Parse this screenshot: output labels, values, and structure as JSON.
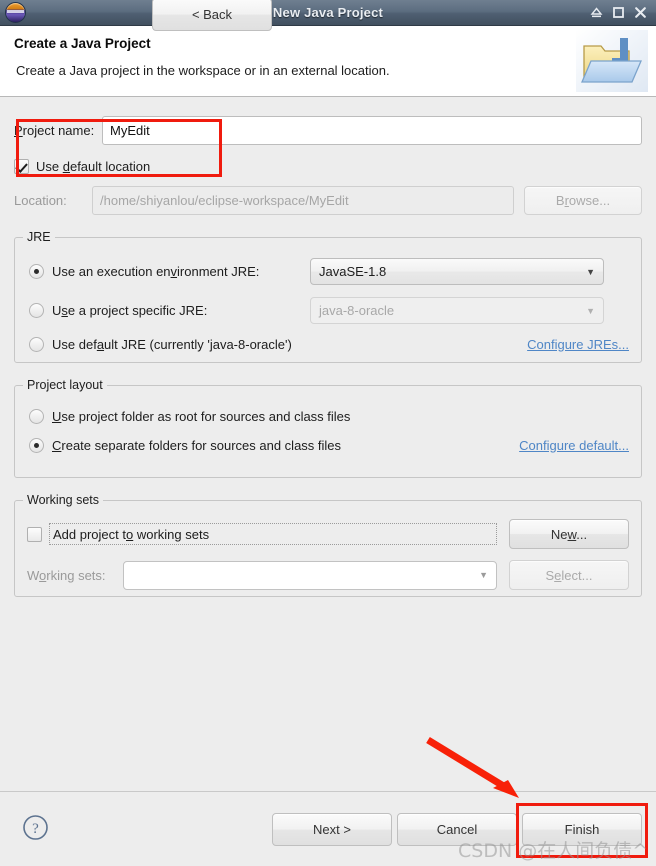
{
  "window": {
    "title": "New Java Project",
    "app_icon": "eclipse-icon",
    "controls": [
      {
        "name": "minimize-button",
        "icon": "minimize-icon"
      },
      {
        "name": "maximize-button",
        "icon": "maximize-icon"
      },
      {
        "name": "close-button",
        "icon": "close-icon"
      }
    ]
  },
  "header": {
    "title": "Create a Java Project",
    "subtitle": "Create a Java project in the workspace or in an external location.",
    "icon": "java-project-folder-icon"
  },
  "project": {
    "name_label": "Project name:",
    "name_label_accel": "P",
    "name_value": "MyEdit",
    "use_default_location_label": "Use default location",
    "use_default_location_accel": "d",
    "use_default_location_checked": true,
    "location_label": "Location:",
    "location_value": "/home/shiyanlou/eclipse-workspace/MyEdit",
    "browse_label": "Browse...",
    "browse_accel": "r",
    "browse_enabled": false
  },
  "jre": {
    "group_title": "JRE",
    "options": [
      {
        "label": "Use an execution environment JRE:",
        "accel": "v",
        "selected": true
      },
      {
        "label": "Use a project specific JRE:",
        "accel": "s",
        "selected": false
      },
      {
        "label": "Use default JRE (currently 'java-8-oracle')",
        "accel": "a",
        "selected": false
      }
    ],
    "execution_env_value": "JavaSE-1.8",
    "specific_jre_value": "java-8-oracle",
    "specific_jre_enabled": false,
    "configure_link": "Configure JREs..."
  },
  "layout": {
    "group_title": "Project layout",
    "options": [
      {
        "label": "Use project folder as root for sources and class files",
        "accel": "U",
        "selected": false
      },
      {
        "label": "Create separate folders for sources and class files",
        "accel": "C",
        "selected": true
      }
    ],
    "configure_link": "Configure default..."
  },
  "working_sets": {
    "group_title": "Working sets",
    "add_label": "Add project to working sets",
    "add_accel": "o",
    "add_checked": false,
    "new_label": "New...",
    "new_accel": "w",
    "sets_label": "Working sets:",
    "sets_label_accel": "o",
    "sets_value": "",
    "select_label": "Select...",
    "select_accel": "e",
    "select_enabled": false
  },
  "footer": {
    "help_icon": "help-question-icon",
    "buttons": [
      {
        "name": "back-button",
        "label": "< Back",
        "enabled": true
      },
      {
        "name": "next-button",
        "label": "Next >",
        "enabled": true
      },
      {
        "name": "cancel-button",
        "label": "Cancel",
        "enabled": true
      },
      {
        "name": "finish-button",
        "label": "Finish",
        "enabled": true
      }
    ]
  },
  "annotations": {
    "watermark": "CSDN @在人间负债^",
    "highlight_color": "#f01b0e"
  }
}
